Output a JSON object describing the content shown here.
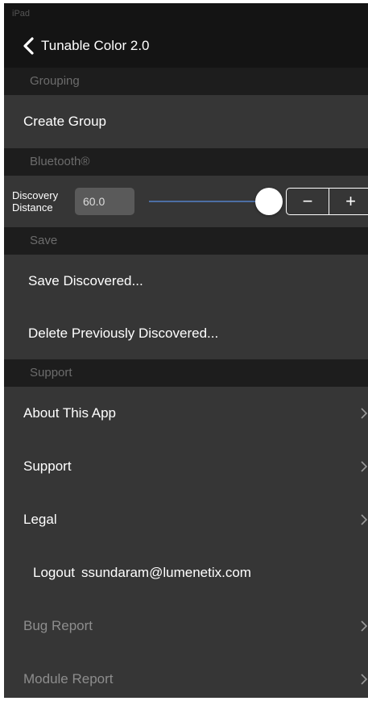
{
  "status_bar": {
    "text": "iPad"
  },
  "nav": {
    "back_title": "Tunable Color 2.0"
  },
  "sections": {
    "grouping": "Grouping",
    "bluetooth": "Bluetooth®",
    "save": "Save",
    "support": "Support"
  },
  "grouping": {
    "create_group": "Create Group"
  },
  "bluetooth": {
    "label_line1": "Discovery",
    "label_line2": "Distance",
    "value": "60.0",
    "slider_fraction": 1.0,
    "minus": "−",
    "plus": "+"
  },
  "save": {
    "save_discovered": "Save Discovered...",
    "delete_discovered": "Delete Previously Discovered..."
  },
  "support": {
    "about": "About This App",
    "support": "Support",
    "legal": "Legal",
    "logout_label": "Logout",
    "logout_user": "ssundaram@lumenetix.com",
    "bug_report": "Bug Report",
    "module_report": "Module Report"
  },
  "icons": {
    "back": "chevron-left-icon",
    "disclosure": "chevron-right-icon"
  },
  "colors": {
    "background": "#363636",
    "section_header": "#1d1d1d",
    "nav_bar": "#141414",
    "slider_track": "#4d6ea4",
    "text_primary": "#ffffff",
    "text_dim": "#8d8d8d",
    "section_text": "#6c6c6c"
  }
}
